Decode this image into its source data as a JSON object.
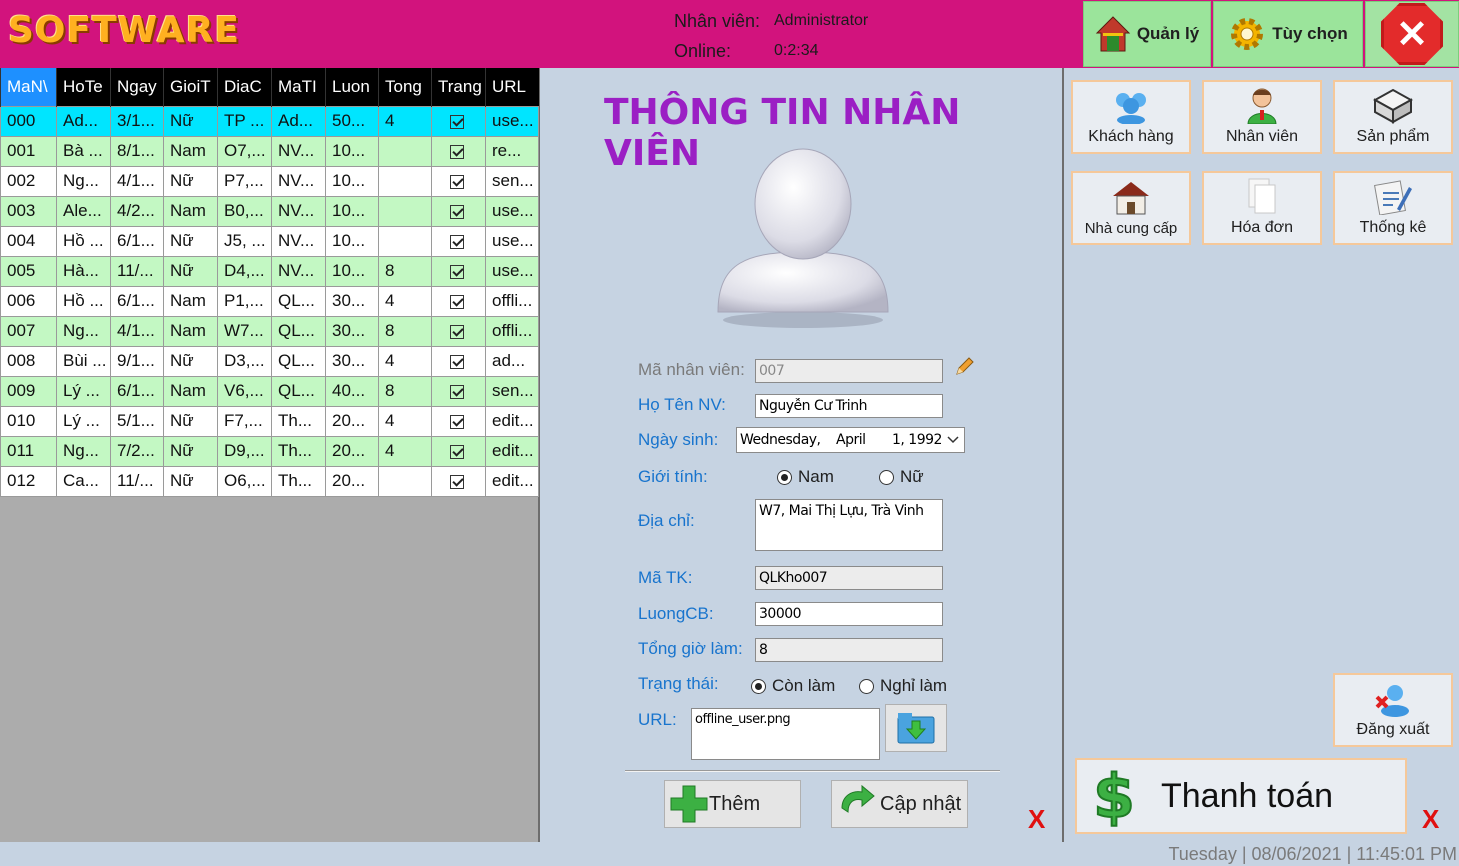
{
  "header": {
    "logo": "SOFTWARE",
    "employee_label": "Nhân viên:",
    "employee_value": "Administrator",
    "online_label": "Online:",
    "online_value": "0:2:34",
    "btn_quanly": "Quản lý",
    "btn_tuychon": "Tùy chọn",
    "close_icon": "close-icon"
  },
  "grid": {
    "columns": [
      "MaNV",
      "HoTen",
      "NgaySinh",
      "GioiTinh",
      "DiaChi",
      "MaTK",
      "LuongCB",
      "TongGio",
      "TrangThai",
      "URL"
    ],
    "column_display": [
      "MaN\\",
      "HoTe",
      "Ngay",
      "GioiT",
      "DiaC",
      "MaTI",
      "Luon",
      "Tong",
      "Trang",
      "URL"
    ],
    "rows": [
      [
        "000",
        "Ad...",
        "3/1...",
        "Nữ",
        "TP ...",
        "Ad...",
        "50...",
        "4",
        true,
        "use..."
      ],
      [
        "001",
        "Bà ...",
        "8/1...",
        "Nam",
        "O7,...",
        "NV...",
        "10...",
        "",
        true,
        "re..."
      ],
      [
        "002",
        "Ng...",
        "4/1...",
        "Nữ",
        "P7,...",
        "NV...",
        "10...",
        "",
        true,
        "sen..."
      ],
      [
        "003",
        "Ale...",
        "4/2...",
        "Nam",
        "B0,...",
        "NV...",
        "10...",
        "",
        true,
        "use..."
      ],
      [
        "004",
        "Hồ ...",
        "6/1...",
        "Nữ",
        "J5, ...",
        "NV...",
        "10...",
        "",
        true,
        "use..."
      ],
      [
        "005",
        "Hà...",
        "11/...",
        "Nữ",
        "D4,...",
        "NV...",
        "10...",
        "8",
        true,
        "use..."
      ],
      [
        "006",
        "Hồ ...",
        "6/1...",
        "Nam",
        "P1,...",
        "QL...",
        "30...",
        "4",
        true,
        "offli..."
      ],
      [
        "007",
        "Ng...",
        "4/1...",
        "Nam",
        "W7...",
        "QL...",
        "30...",
        "8",
        true,
        "offli..."
      ],
      [
        "008",
        "Bùi ...",
        "9/1...",
        "Nữ",
        "D3,...",
        "QL...",
        "30...",
        "4",
        true,
        "ad..."
      ],
      [
        "009",
        "Lý ...",
        "6/1...",
        "Nam",
        "V6,...",
        "QL...",
        "40...",
        "8",
        true,
        "sen..."
      ],
      [
        "010",
        "Lý ...",
        "5/1...",
        "Nữ",
        "F7,...",
        "Th...",
        "20...",
        "4",
        true,
        "edit..."
      ],
      [
        "011",
        "Ng...",
        "7/2...",
        "Nữ",
        "D9,...",
        "Th...",
        "20...",
        "4",
        true,
        "edit..."
      ],
      [
        "012",
        "Ca...",
        "11/...",
        "Nữ",
        "O6,...",
        "Th...",
        "20...",
        "",
        true,
        "edit..."
      ]
    ]
  },
  "form": {
    "title": "THÔNG TIN NHÂN VIÊN",
    "ma_nv_label": "Mã nhân viên:",
    "ma_nv_value": "007",
    "ho_ten_label": "Họ Tên NV:",
    "ho_ten_value": "Nguyễn Cư Trinh",
    "ngay_sinh_label": "Ngày sinh:",
    "ngay_sinh_day": "Wednesday,",
    "ngay_sinh_month": "April",
    "ngay_sinh_date": "1, 1992",
    "gioi_tinh_label": "Giới tính:",
    "gioi_tinh_nam": "Nam",
    "gioi_tinh_nu": "Nữ",
    "dia_chi_label": "Địa chỉ:",
    "dia_chi_value": "W7, Mai Thị Lựu, Trà Vinh",
    "ma_tk_label": "Mã TK:",
    "ma_tk_value": "QLKho007",
    "luong_label": "LuongCB:",
    "luong_value": "30000",
    "tong_gio_label": "Tổng giờ làm:",
    "tong_gio_value": "8",
    "trang_thai_label": "Trạng thái:",
    "trang_thai_con": "Còn làm",
    "trang_thai_nghi": "Nghỉ làm",
    "url_label": "URL:",
    "url_value": "offline_user.png",
    "btn_them": "Thêm",
    "btn_capnhat": "Cập nhật",
    "x_mark": "X"
  },
  "menu": {
    "khach_hang": "Khách hàng",
    "nhan_vien": "Nhân viên",
    "san_pham": "Sản phẩm",
    "nha_cung_cap": "Nhà cung cấp",
    "hoa_don": "Hóa đơn",
    "thong_ke": "Thống kê",
    "dang_xuat": "Đăng xuất",
    "thanh_toan": "Thanh toán",
    "x_mark": "X"
  },
  "status": {
    "text": "Tuesday  |  08/06/2021   |  11:45:01 PM"
  },
  "colors": {
    "header_bg": "#d2137d",
    "accent_green": "#9be49b",
    "row_even": "#c3f8c3",
    "row_selected": "#00e5ff",
    "title_purple": "#9b1fc4",
    "label_blue": "#1874cd"
  }
}
